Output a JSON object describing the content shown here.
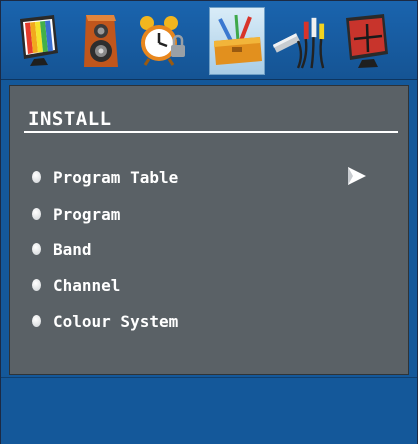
{
  "menu": {
    "title": "INSTALL",
    "items": [
      {
        "label": "Program Table",
        "has_submenu": true
      },
      {
        "label": "Program",
        "has_submenu": false
      },
      {
        "label": "Band",
        "has_submenu": false
      },
      {
        "label": "Channel",
        "has_submenu": false
      },
      {
        "label": "Colour System",
        "has_submenu": false
      }
    ]
  },
  "tabs": [
    {
      "icon": "picture-monitor-icon",
      "active": false
    },
    {
      "icon": "speaker-icon",
      "active": false
    },
    {
      "icon": "alarm-clock-icon",
      "active": false
    },
    {
      "icon": "toolbox-install-icon",
      "active": true
    },
    {
      "icon": "av-cables-icon",
      "active": false
    },
    {
      "icon": "screen-crosshair-icon",
      "active": false
    }
  ],
  "colors": {
    "background_blue": "#14589a",
    "panel_gray": "#5a6166",
    "text": "#ffffff",
    "active_tab": "#bcd9ee"
  }
}
